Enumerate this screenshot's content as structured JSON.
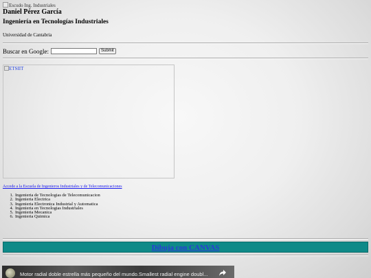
{
  "header": {
    "logo_alt": "Escudo Ing. Industriales",
    "name": "Daniel Pérez García",
    "degree": "Ingeniería en Tecnologías Industriales",
    "university": "Universidad de Cantabria"
  },
  "search": {
    "label": "Buscar en Google:",
    "placeholder": "",
    "submit_label": "Submit"
  },
  "etsiit": {
    "image_alt": "ETSIIT",
    "link_text": "Accede a la Escuela de Ingenieros Industriales y de Telecomunicaciones"
  },
  "degrees": [
    "Ingenieria de Tecnologias de Telecomunicacion",
    "Ingenieria Electrica",
    "Ingenieria Electronica Industrial y Automatica",
    "Ingenieria en Tecnologias Industriales",
    "Ingenieria Mecanica",
    "Ingenieria Quimica"
  ],
  "canvas": {
    "link_text": "Dibuja con CANVAS",
    "bar_color": "#0f8a88"
  },
  "video": {
    "title": "Motor radial doble estrella más pequeño del mundo.Smallest radial engine doubl...",
    "share_icon": "share-arrow-icon"
  }
}
